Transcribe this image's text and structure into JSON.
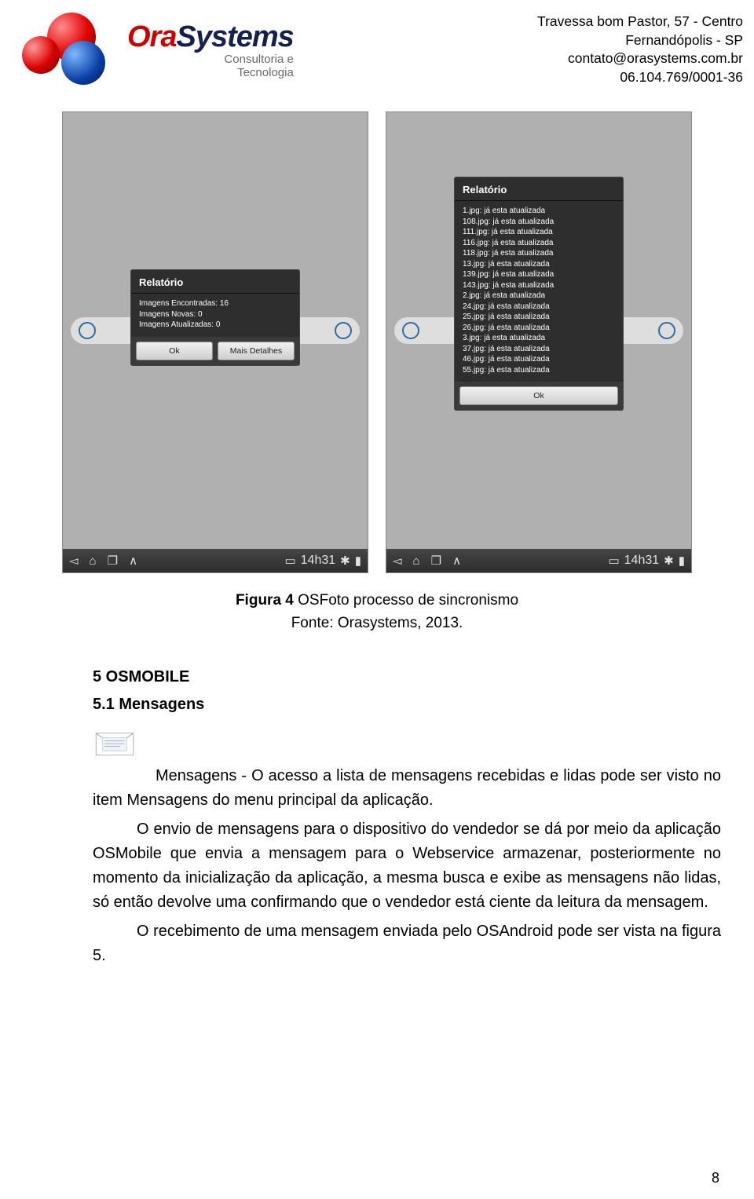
{
  "header": {
    "logo_brand_ora": "Ora",
    "logo_brand_systems": "Systems",
    "logo_sub1": "Consultoria e",
    "logo_sub2": "Tecnologia",
    "addr1": "Travessa bom Pastor, 57 - Centro",
    "addr2": "Fernandópolis - SP",
    "addr3": "contato@orasystems.com.br",
    "addr4": "06.104.769/0001-36"
  },
  "screens": {
    "dialog1": {
      "title": "Relatório",
      "line1": "Imagens Encontradas: 16",
      "line2": "Imagens Novas: 0",
      "line3": "Imagens Atualizadas: 0",
      "btn_ok": "Ok",
      "btn_more": "Mais Detalhes"
    },
    "dialog2": {
      "title": "Relatório",
      "lines": "1.jpg: já esta atualizada\n108.jpg: já esta atualizada\n111.jpg: já esta atualizada\n116.jpg: já esta atualizada\n118.jpg: já esta atualizada\n13.jpg: já esta atualizada\n139.jpg: já esta atualizada\n143.jpg: já esta atualizada\n2.jpg: já esta atualizada\n24.jpg: já esta atualizada\n25.jpg: já esta atualizada\n26.jpg: já esta atualizada\n3.jpg: já esta atualizada\n37.jpg: já esta atualizada\n46.jpg: já esta atualizada\n55.jpg: já esta atualizada",
      "btn_ok": "Ok"
    },
    "clock": "14h31"
  },
  "caption": {
    "label": "Figura 4",
    "text": " OSFoto processo de sincronismo",
    "source": "Fonte: Orasystems, 2013."
  },
  "content": {
    "h5": "5 OSMOBILE",
    "h51": "5.1 Mensagens",
    "p1a": "Mensagens - O acesso a lista de mensagens recebidas e lidas pode ser visto no item Mensagens do menu principal da aplicação.",
    "p2": "O envio de mensagens para o dispositivo do vendedor se dá por meio da aplicação OSMobile que envia a mensagem para o Webservice armazenar, posteriormente no momento da inicialização da aplicação, a mesma busca e exibe as mensagens  não lidas, só então devolve uma confirmando que o vendedor está ciente da leitura da mensagem.",
    "p3": "O recebimento de uma mensagem enviada pelo OSAndroid pode ser vista na figura 5."
  },
  "page_number": "8"
}
